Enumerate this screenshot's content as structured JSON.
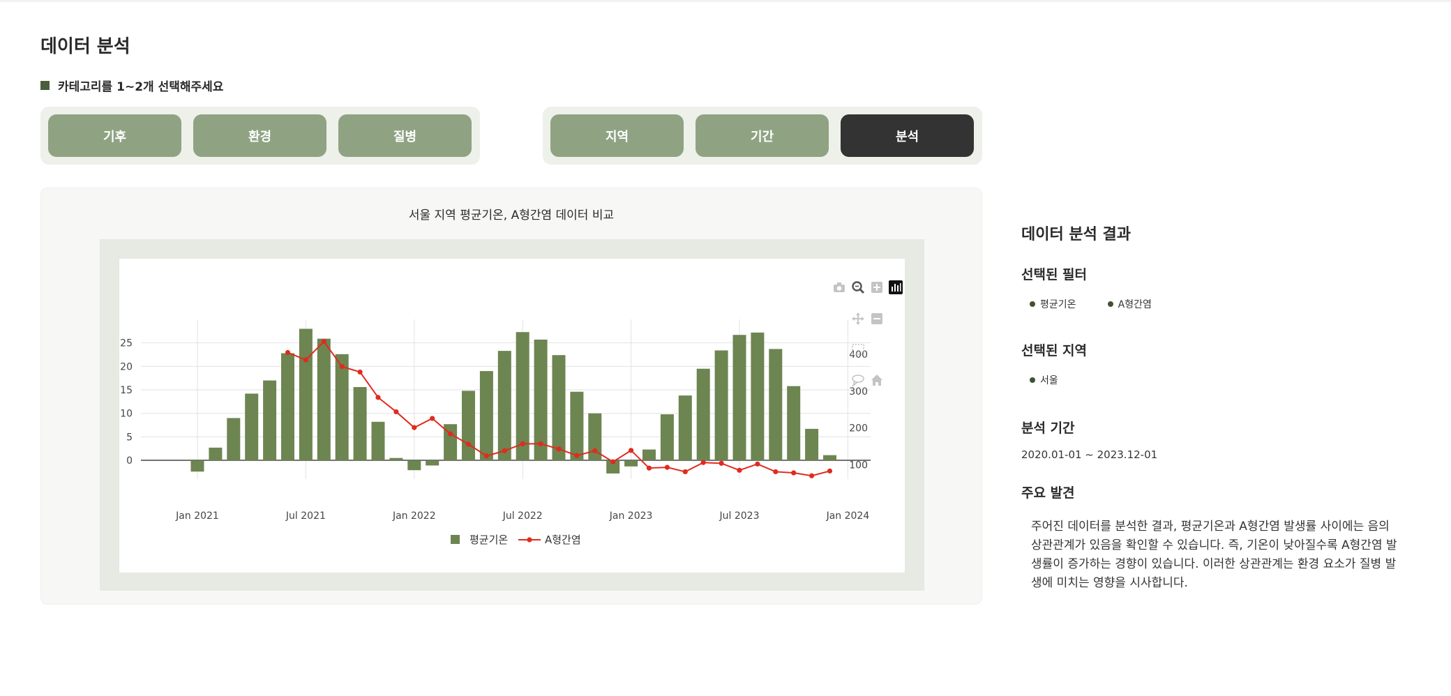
{
  "page_title": "데이터 분석",
  "instruction": "카테고리를 1~2개 선택해주세요",
  "category_buttons": [
    "기후",
    "환경",
    "질병"
  ],
  "filter_buttons": [
    "지역",
    "기간",
    "분석"
  ],
  "active_button": "분석",
  "colors": {
    "button": "#8fa383",
    "button_active": "#333333",
    "bar": "#6d8551",
    "line": "#e02b20",
    "accent_square": "#4a5e3c"
  },
  "chart_title": "서울 지역 평균기온, A형간염 데이터 비교",
  "modebar_icons": [
    "camera-icon",
    "zoom-icon",
    "plus-icon",
    "bar-icon",
    "pan-icon",
    "minus-icon",
    "select-box-icon",
    "lasso-icon",
    "home-icon"
  ],
  "chart_data": {
    "type": "bar",
    "x": [
      "2021-01",
      "2021-02",
      "2021-03",
      "2021-04",
      "2021-05",
      "2021-06",
      "2021-07",
      "2021-08",
      "2021-09",
      "2021-10",
      "2021-11",
      "2021-12",
      "2022-01",
      "2022-02",
      "2022-03",
      "2022-04",
      "2022-05",
      "2022-06",
      "2022-07",
      "2022-08",
      "2022-09",
      "2022-10",
      "2022-11",
      "2022-12",
      "2023-01",
      "2023-02",
      "2023-03",
      "2023-04",
      "2023-05",
      "2023-06",
      "2023-07",
      "2023-08",
      "2023-09",
      "2023-10",
      "2023-11",
      "2023-12"
    ],
    "series": [
      {
        "name": "평균기온",
        "type": "bar",
        "axis": "y",
        "values": [
          -2.4,
          2.7,
          9.0,
          14.2,
          17.0,
          22.8,
          28.0,
          25.9,
          22.6,
          15.6,
          8.2,
          0.5,
          -2.1,
          -1.1,
          7.7,
          14.8,
          19.0,
          23.3,
          27.3,
          25.7,
          22.4,
          14.6,
          10.0,
          -2.8,
          -1.3,
          2.3,
          9.8,
          13.8,
          19.5,
          23.4,
          26.7,
          27.2,
          23.7,
          15.8,
          6.7,
          1.1
        ]
      },
      {
        "name": "A형간염",
        "type": "line",
        "axis": "y2",
        "x_start_index": 5,
        "values": [
          405,
          385,
          435,
          367,
          352,
          283,
          244,
          201,
          226,
          184,
          156,
          124,
          138,
          157,
          157,
          143,
          125,
          138,
          108,
          139,
          91,
          93,
          81,
          106,
          104,
          85,
          102,
          81,
          78,
          70,
          83
        ]
      }
    ],
    "x_ticks": [
      "Jan 2021",
      "Jul 2021",
      "Jan 2022",
      "Jul 2022",
      "Jan 2023",
      "Jul 2023",
      "Jan 2024"
    ],
    "y_ticks": [
      0,
      5,
      10,
      15,
      20,
      25
    ],
    "y2_ticks": [
      100,
      200,
      300,
      400
    ],
    "ylim": [
      -4,
      30
    ],
    "y2lim": [
      61,
      495
    ],
    "grid": true,
    "legend_position": "bottom-center"
  },
  "results": {
    "heading": "데이터 분석 결과",
    "filters_heading": "선택된 필터",
    "filters": [
      "평균기온",
      "A형간염"
    ],
    "region_heading": "선택된 지역",
    "regions": [
      "서울"
    ],
    "period_heading": "분석 기간",
    "period": "2020.01-01 ~ 2023.12-01",
    "findings_heading": "주요 발견",
    "findings_lines": [
      "주어진 데이터를 분석한 결과, 평균기온과 A형간염 발생률 사이에는 음의",
      "상관관계가 있음을 확인할 수 있습니다. 즉, 기온이 낮아질수록 A형간염 발",
      "생률이 증가하는 경향이 있습니다. 이러한 상관관계는 환경 요소가 질병 발",
      "생에 미치는 영향을 시사합니다."
    ]
  }
}
